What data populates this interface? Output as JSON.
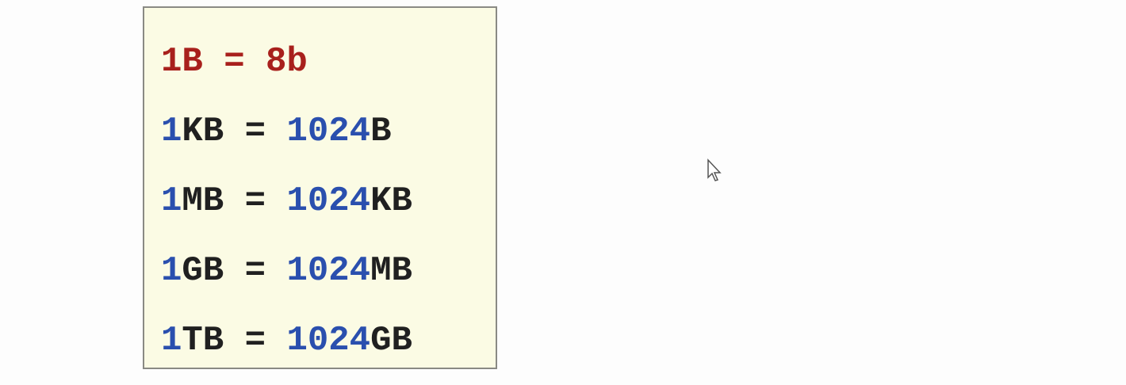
{
  "rows": [
    {
      "parts": [
        "1B",
        " = ",
        "8b"
      ]
    },
    {
      "parts": [
        "1",
        "KB",
        " = ",
        "1024",
        "B"
      ]
    },
    {
      "parts": [
        "1",
        "MB",
        " = ",
        "1024",
        "KB"
      ]
    },
    {
      "parts": [
        "1",
        "GB",
        " = ",
        "1024",
        "MB"
      ]
    },
    {
      "parts": [
        "1",
        "TB",
        " = ",
        "1024",
        "GB"
      ]
    }
  ],
  "colors": {
    "red": "#a8201c",
    "blue": "#2a4fae",
    "text": "#202020",
    "box_bg": "#fbfbe4"
  }
}
